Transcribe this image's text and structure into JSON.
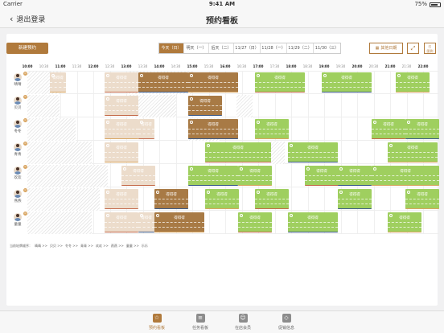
{
  "status_bar": {
    "carrier": "Carrier",
    "time": "9:41 AM",
    "battery": "75%"
  },
  "nav": {
    "back_label": "退出登录",
    "title": "预约看板"
  },
  "toolbar": {
    "new_booking": "新建预约",
    "date_tabs": [
      "今天（日）",
      "明天（一）",
      "后天（二）",
      "11/27（日）",
      "11/28（一）",
      "11/29（二）",
      "11/30（三）"
    ],
    "other_date": "其他日期",
    "legend_label": "图例"
  },
  "timeline": [
    "10:00",
    "10:30",
    "11:00",
    "11:30",
    "12:00",
    "12:30",
    "13:00",
    "13:30",
    "14:00",
    "14:30",
    "15:00",
    "15:30",
    "16:00",
    "16:30",
    "17:00",
    "17:30",
    "18:00",
    "18:30",
    "19:00",
    "19:30",
    "20:00",
    "20:30",
    "21:00",
    "21:30",
    "22:00"
  ],
  "staff": [
    {
      "name": "晴晴"
    },
    {
      "name": "贝贝"
    },
    {
      "name": "冬冬"
    },
    {
      "name": "青青"
    },
    {
      "name": "欢欢"
    },
    {
      "name": "燕燕"
    },
    {
      "name": "童童"
    }
  ],
  "booking_name": "得得得",
  "legend": {
    "title": "当前轮牌顺序：",
    "items": [
      "晴晴 >>",
      "贝贝 >>",
      "冬冬 >>",
      "青青 >>",
      "欢欢 >>",
      "燕燕 >>",
      "童童 >>",
      "乐乐"
    ]
  },
  "tabs": [
    {
      "label": "预约看板"
    },
    {
      "label": "任务看板"
    },
    {
      "label": "在店会员"
    },
    {
      "label": "促销信息"
    }
  ],
  "colors": {
    "accent": "#b07a3c",
    "served": "#a87a45",
    "booked": "#9fcf5f",
    "pending": "#ecdccb"
  }
}
